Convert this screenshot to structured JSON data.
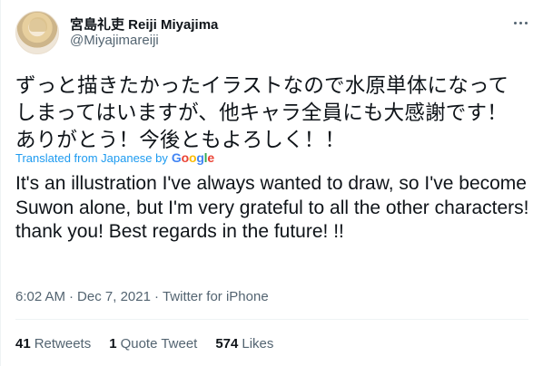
{
  "author": {
    "display_name": "宮島礼吏 Reiji Miyajima",
    "handle": "@Miyajimareiji"
  },
  "tweet": {
    "original_text": "ずっと描きたかったイラストなので水原単体になって\nしまってはいますが、他キャラ全員にも大感謝です！\nありがとう！今後ともよろしく！！",
    "translated_label": "Translated from Japanese by",
    "translator_brand": "Google",
    "translation": "It's an illustration I've always wanted to draw, so I've become Suwon alone, but I'm very grateful to all the other characters! thank you! Best regards in the future! !!",
    "time": "6:02 AM",
    "date": "Dec 7, 2021",
    "client": "Twitter for iPhone",
    "separator": "·"
  },
  "stats": {
    "retweets_count": "41",
    "retweets_label": "Retweets",
    "quotes_count": "1",
    "quotes_label": "Quote Tweet",
    "likes_count": "574",
    "likes_label": "Likes"
  },
  "colors": {
    "link": "#1d9bf0",
    "secondary_text": "#536471",
    "primary_text": "#0f1419"
  }
}
